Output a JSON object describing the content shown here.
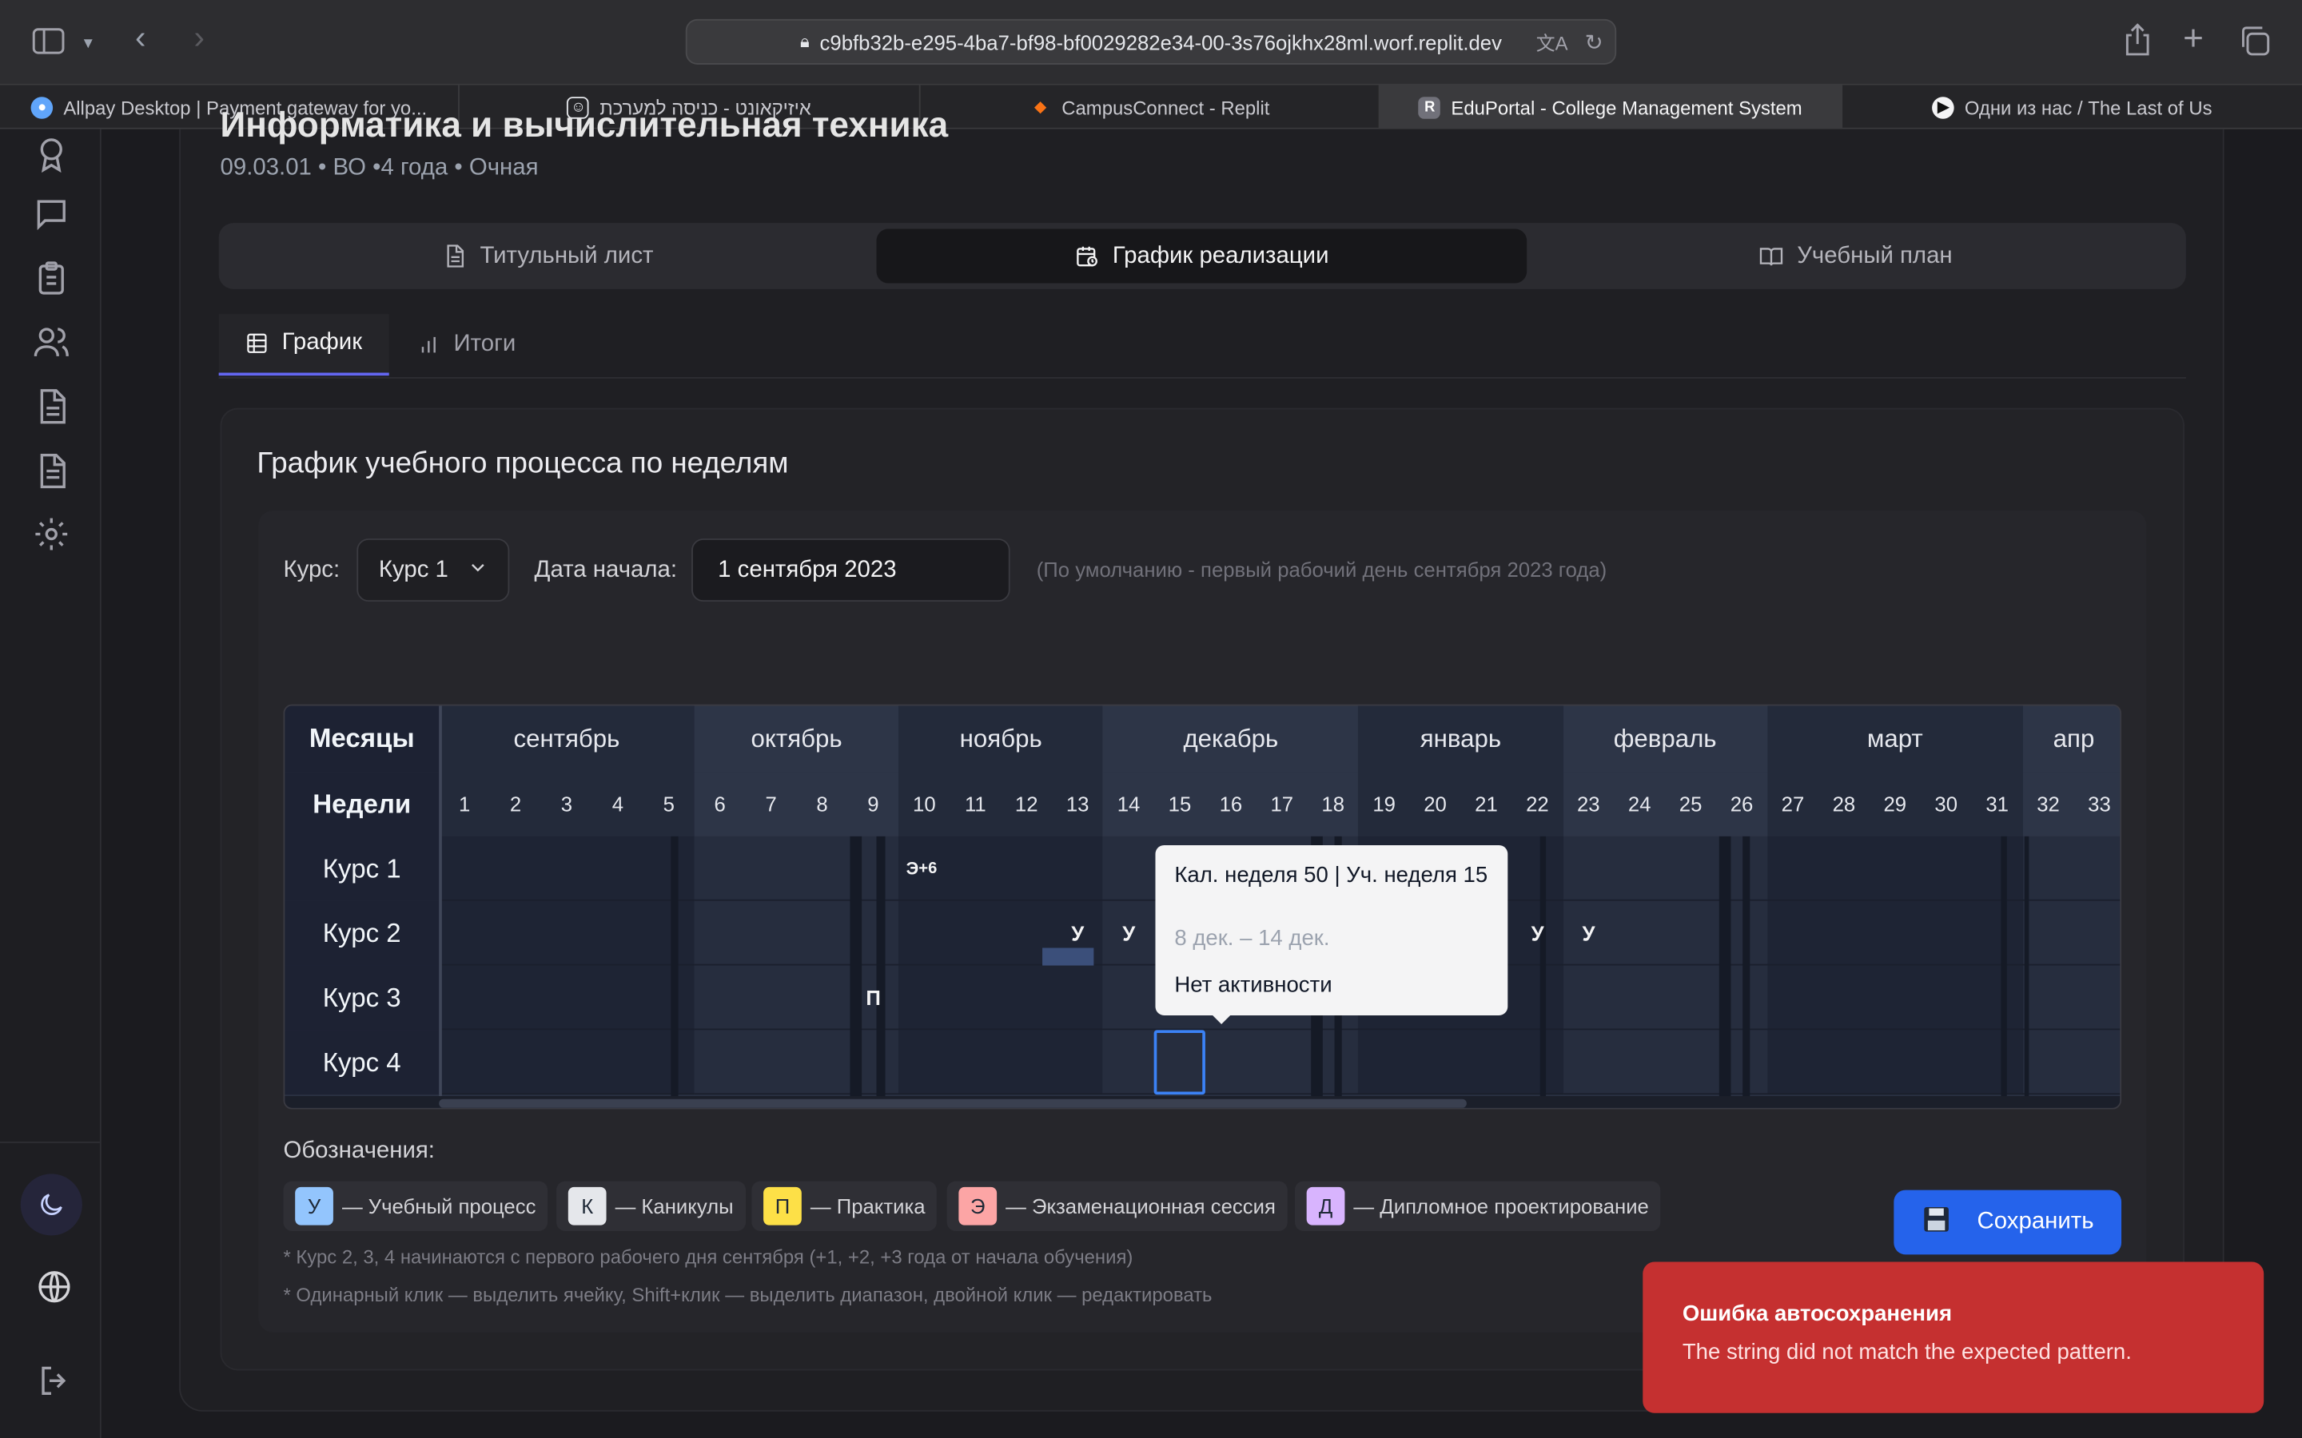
{
  "browser": {
    "url": "c9bfb32b-e295-4ba7-bf98-bf0029282e34-00-3s76ojkhx28ml.worf.replit.dev",
    "tabs": [
      {
        "label": "Allpay Desktop | Payment gateway for yo..."
      },
      {
        "label": "איזיקאונט - כניסה למערכת"
      },
      {
        "label": "CampusConnect - Replit"
      },
      {
        "label": "EduPortal - College Management System"
      },
      {
        "label": "Одни из нас / The Last of Us"
      }
    ]
  },
  "page": {
    "title": "Информатика и вычислительная техника",
    "subtitle": "09.03.01 • ВО •4 года • Очная"
  },
  "sections": [
    {
      "label": "Титульный лист",
      "icon": "document-icon"
    },
    {
      "label": "График реализации",
      "icon": "calendar-clock-icon"
    },
    {
      "label": "Учебный план",
      "icon": "book-open-icon"
    }
  ],
  "subtabs": [
    {
      "label": "График",
      "icon": "table-icon"
    },
    {
      "label": "Итоги",
      "icon": "bar-chart-icon"
    }
  ],
  "schedule": {
    "heading": "График учебного процесса по неделям",
    "course_label": "Курс:",
    "course_value": "Курс 1",
    "start_label": "Дата начала:",
    "start_value": "1 сентября 2023",
    "start_hint": "(По умолчанию - первый рабочий день сентября 2023 года)",
    "months_header": "Месяцы",
    "weeks_header": "Недели",
    "months": [
      "сентябрь",
      "октябрь",
      "ноябрь",
      "декабрь",
      "январь",
      "февраль",
      "март",
      "апр"
    ],
    "weeks": [
      "1",
      "2",
      "3",
      "4",
      "5",
      "6",
      "7",
      "8",
      "9",
      "10",
      "11",
      "12",
      "13",
      "14",
      "15",
      "16",
      "17",
      "18",
      "19",
      "20",
      "21",
      "22",
      "23",
      "24",
      "25",
      "26",
      "27",
      "28",
      "29",
      "30",
      "31",
      "32",
      "33"
    ],
    "rows": [
      "Курс 1",
      "Курс 2",
      "Курс 3",
      "Курс 4"
    ],
    "marks": {
      "course1_exam": "Э",
      "course1_exam_extra": "+6",
      "course2_study": "У",
      "course3_practice": "П"
    }
  },
  "tooltip": {
    "title": "Кал. неделя 50 | Уч. неделя 15",
    "dates": "8 дек. – 14 дек.",
    "status": "Нет активности"
  },
  "legend": {
    "title": "Обозначения:",
    "items": [
      {
        "code": "У",
        "label": "— Учебный процесс",
        "color": "#93c5fd"
      },
      {
        "code": "К",
        "label": "— Каникулы",
        "color": "#e5e7eb"
      },
      {
        "code": "П",
        "label": "— Практика",
        "color": "#fde047"
      },
      {
        "code": "Э",
        "label": "— Экзаменационная сессия",
        "color": "#fca5a5"
      },
      {
        "code": "Д",
        "label": "— Дипломное проектирование",
        "color": "#d8b4fe"
      }
    ],
    "note1": "* Курс 2, 3, 4 начинаются с первого рабочего дня сентября (+1, +2, +3 года от начала обучения)",
    "note2": "* Одинарный клик — выделить ячейку, Shift+клик — выделить диапазон, двойной клик — редактировать"
  },
  "save_button": "Сохранить",
  "toast": {
    "title": "Ошибка автосохранения",
    "message": "The string did not match the expected pattern."
  },
  "colors": {
    "accent": "#6366f1",
    "save": "#2563eb",
    "error": "#c53030"
  }
}
